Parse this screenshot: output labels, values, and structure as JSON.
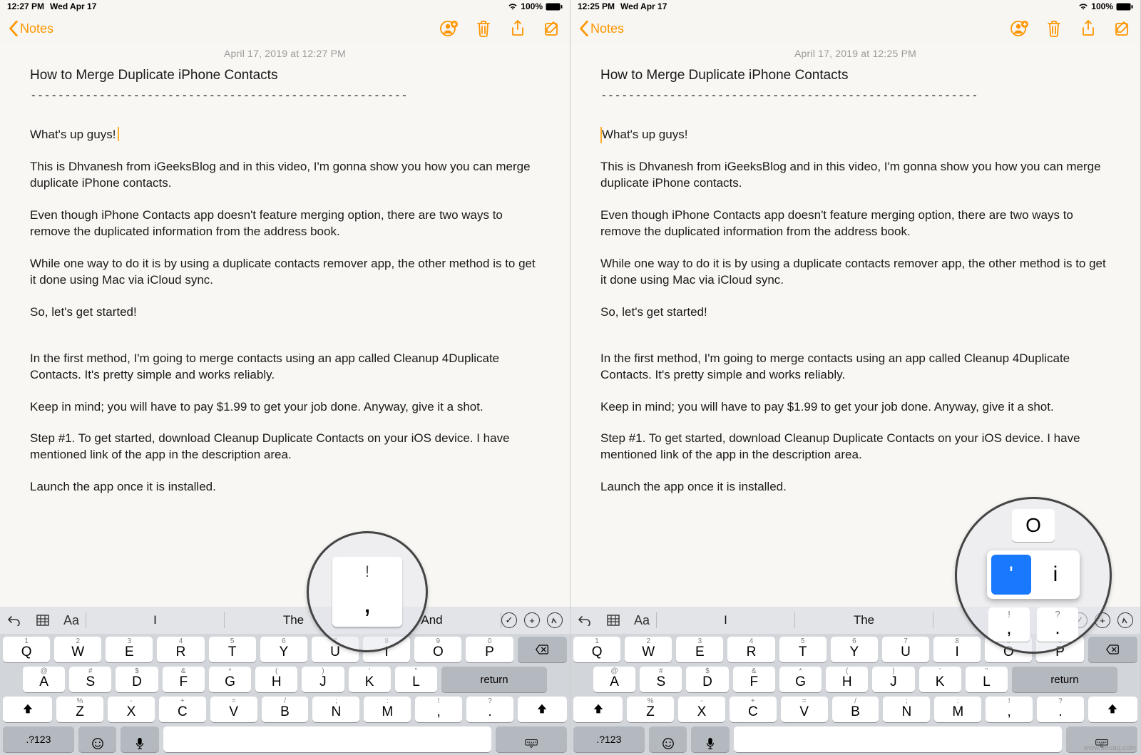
{
  "left": {
    "status": {
      "time": "12:27 PM",
      "date": "Wed Apr 17",
      "battery": "100%"
    },
    "nav": {
      "back_label": "Notes"
    },
    "note_date": "April 17, 2019 at 12:27 PM",
    "title": "How to Merge Duplicate iPhone Contacts",
    "dashes": "-------------------------------------------------------",
    "p_whatsup": "What's up guys!",
    "p_intro": "This is Dhvanesh from iGeeksBlog and in this video, I'm gonna show you how you can merge duplicate iPhone contacts.",
    "p_even": "Even though iPhone Contacts app doesn't feature merging option, there are two ways to remove the duplicated information from the address book.",
    "p_while": "While one way to do it is by using a duplicate contacts remover app, the other method is to get it done using Mac via iCloud sync.",
    "p_so": "So, let's get started!",
    "p_first": "In the first method, I'm going to merge contacts using an app called Cleanup 4Duplicate Contacts. It's pretty simple and works reliably.",
    "p_keep": "Keep in mind; you will have to pay $1.99 to get your job done. Anyway, give it a shot.",
    "p_step1": "Step #1. To get started, download Cleanup Duplicate Contacts on your iOS device.  I have mentioned link of the app in the description area.",
    "p_launch": "Launch the app once it is installed.",
    "lens": {
      "alt": "!",
      "main": ","
    }
  },
  "right": {
    "status": {
      "time": "12:25 PM",
      "date": "Wed Apr 17",
      "battery": "100%"
    },
    "nav": {
      "back_label": "Notes"
    },
    "note_date": "April 17, 2019 at 12:25 PM",
    "title": "How to Merge Duplicate iPhone Contacts",
    "dashes": "-------------------------------------------------------",
    "p_whatsup": "What's up guys!",
    "p_intro": "This is Dhvanesh from iGeeksBlog and in this video, I'm gonna show you how you can merge duplicate iPhone contacts.",
    "p_even": "Even though iPhone Contacts app doesn't feature merging option, there are two ways to remove the duplicated information from the address book.",
    "p_while": "While one way to do it is by using a duplicate contacts remover app, the other method is to get it done using Mac via iCloud sync.",
    "p_so": "So, let's get started!",
    "p_first": "In the first method, I'm going to merge contacts using an app called Cleanup 4Duplicate Contacts. It's pretty simple and works reliably.",
    "p_keep": "Keep in mind; you will have to pay $1.99 to get your job done. Anyway, give it a shot.",
    "p_step1": "Step #1. To get started, download Cleanup Duplicate Contacts on your iOS device.  I have mentioned link of the app in the description area.",
    "p_launch": "Launch the app once it is installed.",
    "lens": {
      "above_key_letter": "O",
      "popup_sel": "'",
      "popup_alt": "i",
      "below_comma_alt": "!",
      "below_comma_main": ",",
      "below_dot_alt": "?",
      "below_dot_main": "."
    }
  },
  "suggestions": {
    "w1": "I",
    "w2": "The",
    "w3": "And",
    "aa": "Aa"
  },
  "keyboard": {
    "row1": [
      {
        "m": "Q",
        "a": "1"
      },
      {
        "m": "W",
        "a": "2"
      },
      {
        "m": "E",
        "a": "3"
      },
      {
        "m": "R",
        "a": "4"
      },
      {
        "m": "T",
        "a": "5"
      },
      {
        "m": "Y",
        "a": "6"
      },
      {
        "m": "U",
        "a": "7"
      },
      {
        "m": "I",
        "a": "8"
      },
      {
        "m": "O",
        "a": "9"
      },
      {
        "m": "P",
        "a": "0"
      }
    ],
    "row2": [
      {
        "m": "A",
        "a": "@"
      },
      {
        "m": "S",
        "a": "#"
      },
      {
        "m": "D",
        "a": "$"
      },
      {
        "m": "F",
        "a": "&"
      },
      {
        "m": "G",
        "a": "*"
      },
      {
        "m": "H",
        "a": "("
      },
      {
        "m": "J",
        "a": ")"
      },
      {
        "m": "K",
        "a": "'"
      },
      {
        "m": "L",
        "a": "\""
      }
    ],
    "return_label": "return",
    "row3": [
      {
        "m": "Z",
        "a": "%"
      },
      {
        "m": "X",
        "a": "-"
      },
      {
        "m": "C",
        "a": "+"
      },
      {
        "m": "V",
        "a": "="
      },
      {
        "m": "B",
        "a": "/"
      },
      {
        "m": "N",
        "a": ";"
      },
      {
        "m": "M",
        "a": ":"
      },
      {
        "m": ",",
        "a": "!"
      },
      {
        "m": ".",
        "a": "?"
      }
    ],
    "mode_label": ".?123"
  },
  "watermark": "www.deuaq.com"
}
